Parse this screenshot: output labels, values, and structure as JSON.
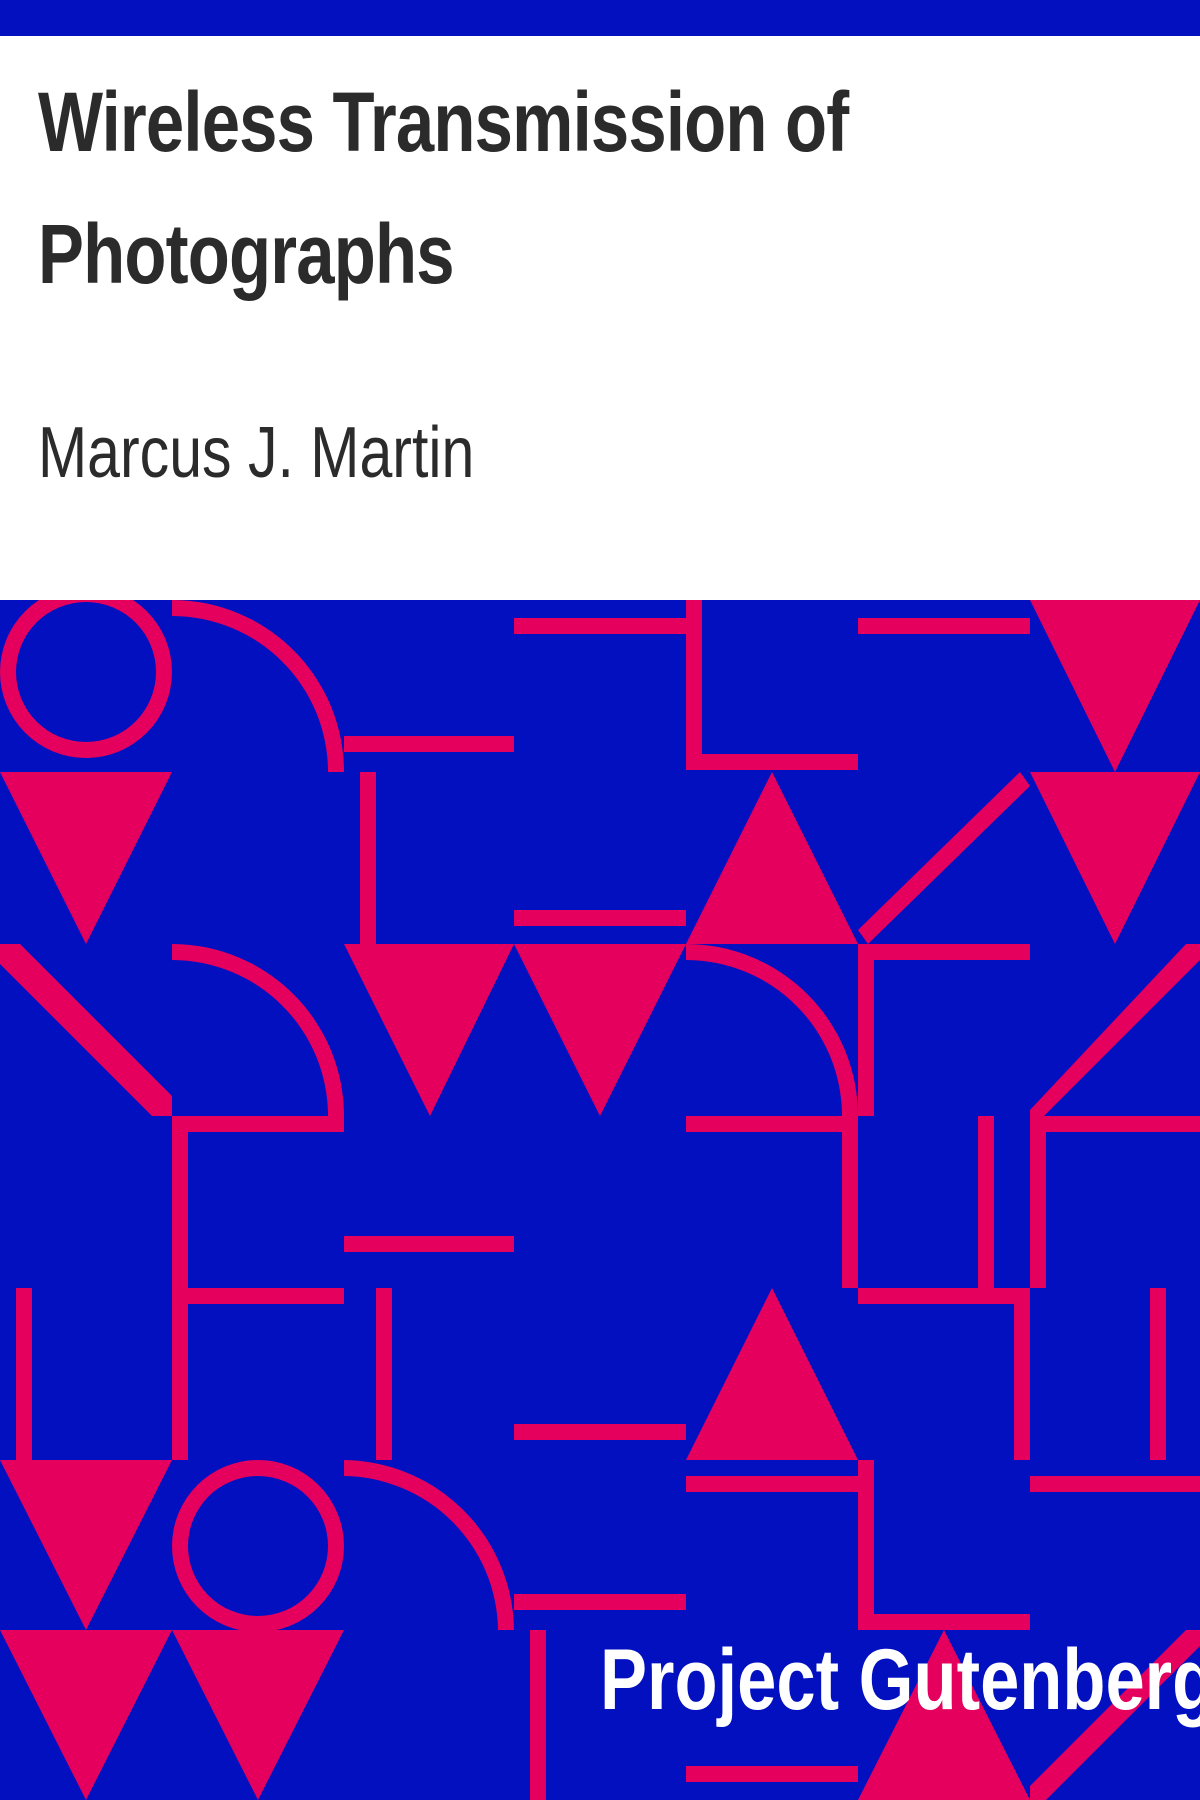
{
  "cover": {
    "title": "Wireless Transmission of Photographs",
    "author": "Marcus J. Martin",
    "publisher": "Project Gutenberg"
  },
  "colors": {
    "background_blue": "#0210bf",
    "pattern_pink": "#e5005e",
    "title_text": "#2b2b2b",
    "publisher_text": "#ffffff"
  }
}
